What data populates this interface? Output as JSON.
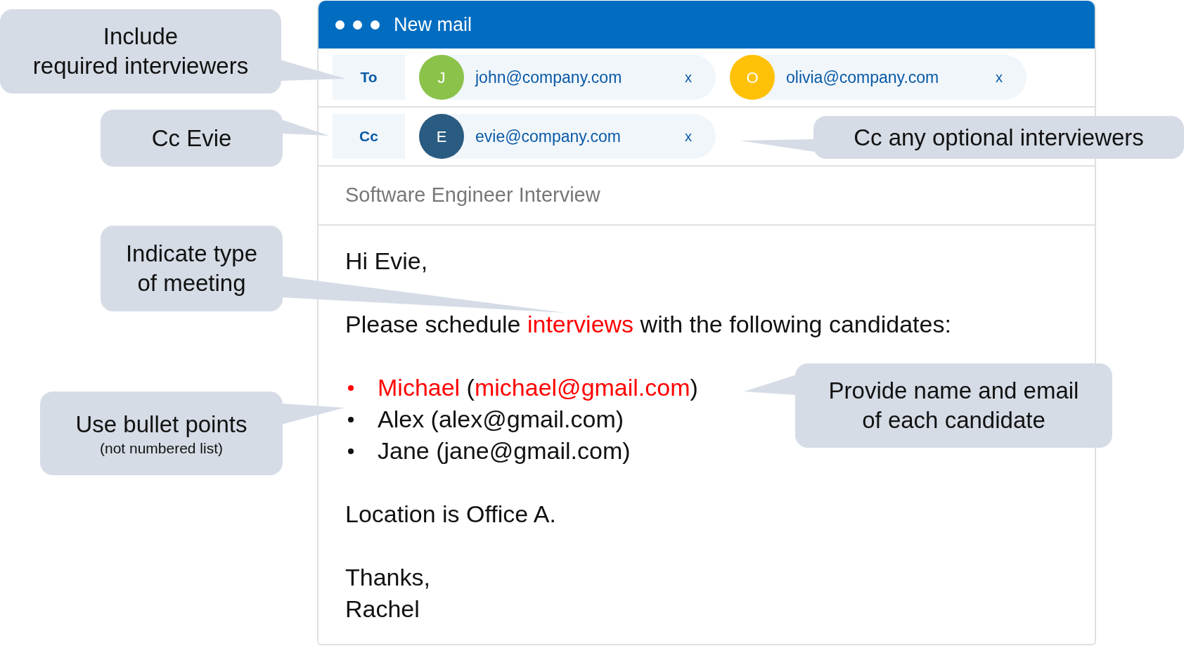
{
  "window": {
    "title": "New mail"
  },
  "recipient_rows": [
    {
      "label": "To",
      "recipients": [
        {
          "initial": "J",
          "email": "john@company.com",
          "color": "#8bc34a",
          "remove": "x"
        },
        {
          "initial": "O",
          "email": "olivia@company.com",
          "color": "#ffc107",
          "remove": "x"
        }
      ]
    },
    {
      "label": "Cc",
      "recipients": [
        {
          "initial": "E",
          "email": "evie@company.com",
          "color": "#2a5b80",
          "remove": "x"
        }
      ]
    }
  ],
  "subject": "Software Engineer Interview",
  "body": [
    {
      "kind": "line",
      "segments": [
        {
          "text": "Hi Evie,",
          "highlighted": false
        }
      ]
    },
    {
      "kind": "line",
      "segments": [
        {
          "text": "Please schedule ",
          "highlighted": false
        },
        {
          "text": "interviews",
          "highlighted": true
        },
        {
          "text": " with the following candidates:",
          "highlighted": false
        }
      ]
    },
    {
      "kind": "bullets",
      "items": [
        {
          "highlighted": true,
          "segments": [
            {
              "text": "Michael",
              "highlighted": true
            },
            {
              "text": " (",
              "highlighted": false
            },
            {
              "text": "michael@gmail.com",
              "highlighted": true
            },
            {
              "text": ")",
              "highlighted": false
            }
          ]
        },
        {
          "highlighted": false,
          "segments": [
            {
              "text": "Alex (alex@gmail.com)",
              "highlighted": false
            }
          ]
        },
        {
          "highlighted": false,
          "segments": [
            {
              "text": "Jane (jane@gmail.com)",
              "highlighted": false
            }
          ]
        }
      ]
    },
    {
      "kind": "line",
      "segments": [
        {
          "text": "Location is Office A.",
          "highlighted": false
        }
      ]
    },
    {
      "kind": "lines",
      "lines": [
        "Thanks,",
        "Rachel"
      ]
    }
  ],
  "callouts": [
    {
      "text": "Include\nrequired interviewers"
    },
    {
      "text": "Cc Evie"
    },
    {
      "text": "Cc any optional interviewers"
    },
    {
      "text": "Indicate type\nof meeting"
    },
    {
      "text": "Use bullet points",
      "note": "(not numbered list)"
    },
    {
      "text": "Provide name and email\nof each candidate"
    }
  ]
}
